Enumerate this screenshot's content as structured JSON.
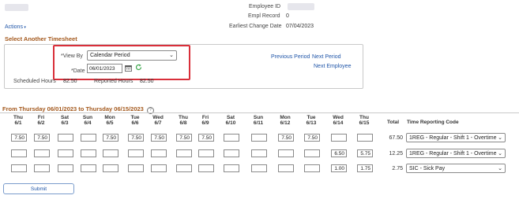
{
  "header": {
    "employee_id_label": "Employee ID",
    "empl_record_label": "Empl Record",
    "empl_record_value": "0",
    "earliest_change_label": "Earliest Change Date",
    "earliest_change_value": "07/04/2023",
    "actions_label": "Actions"
  },
  "timesheet": {
    "section_title": "Select Another Timesheet",
    "view_by_label": "*View By",
    "view_by_value": "Calendar Period",
    "date_label": "*Date",
    "date_value": "06/01/2023",
    "scheduled_hours_label": "Scheduled Hours",
    "scheduled_hours_value": "82.50",
    "reported_hours_label": "Reported Hours",
    "reported_hours_value": "82.50",
    "previous_period": "Previous Period",
    "next_period": "Next Period",
    "next_employee": "Next Employee"
  },
  "grid": {
    "range_title": "From Thursday 06/01/2023 to Thursday 06/15/2023",
    "days": [
      {
        "dow": "Thu",
        "date": "6/1"
      },
      {
        "dow": "Fri",
        "date": "6/2"
      },
      {
        "dow": "Sat",
        "date": "6/3"
      },
      {
        "dow": "Sun",
        "date": "6/4"
      },
      {
        "dow": "Mon",
        "date": "6/5"
      },
      {
        "dow": "Tue",
        "date": "6/6"
      },
      {
        "dow": "Wed",
        "date": "6/7"
      },
      {
        "dow": "Thu",
        "date": "6/8"
      },
      {
        "dow": "Fri",
        "date": "6/9"
      },
      {
        "dow": "Sat",
        "date": "6/10"
      },
      {
        "dow": "Sun",
        "date": "6/11"
      },
      {
        "dow": "Mon",
        "date": "6/12"
      },
      {
        "dow": "Tue",
        "date": "6/13"
      },
      {
        "dow": "Wed",
        "date": "6/14"
      },
      {
        "dow": "Thu",
        "date": "6/15"
      }
    ],
    "total_label": "Total",
    "trc_label": "Time Reporting Code",
    "rows": [
      {
        "cells": [
          "7.50",
          "7.50",
          "",
          "",
          "7.50",
          "7.50",
          "7.50",
          "7.50",
          "7.50",
          "",
          "",
          "7.50",
          "7.50",
          "",
          ""
        ],
        "total": "67.50",
        "trc": "1REG - Regular - Shift 1 - Overtime"
      },
      {
        "cells": [
          "",
          "",
          "",
          "",
          "",
          "",
          "",
          "",
          "",
          "",
          "",
          "",
          "",
          "6.50",
          "5.75"
        ],
        "total": "12.25",
        "trc": "1REG - Regular - Shift 1 - Overtime"
      },
      {
        "cells": [
          "",
          "",
          "",
          "",
          "",
          "",
          "",
          "",
          "",
          "",
          "",
          "",
          "",
          "1.00",
          "1.75"
        ],
        "total": "2.75",
        "trc": "SIC - Sick Pay"
      }
    ],
    "submit_label": "Submit"
  },
  "colors": {
    "highlight": "#d92f3a",
    "link": "#1f55a8",
    "section": "#a3581c",
    "refresh": "#3aa54a"
  },
  "icons": [
    "calendar-icon",
    "refresh-icon",
    "help-icon",
    "chevron-down-icon"
  ]
}
